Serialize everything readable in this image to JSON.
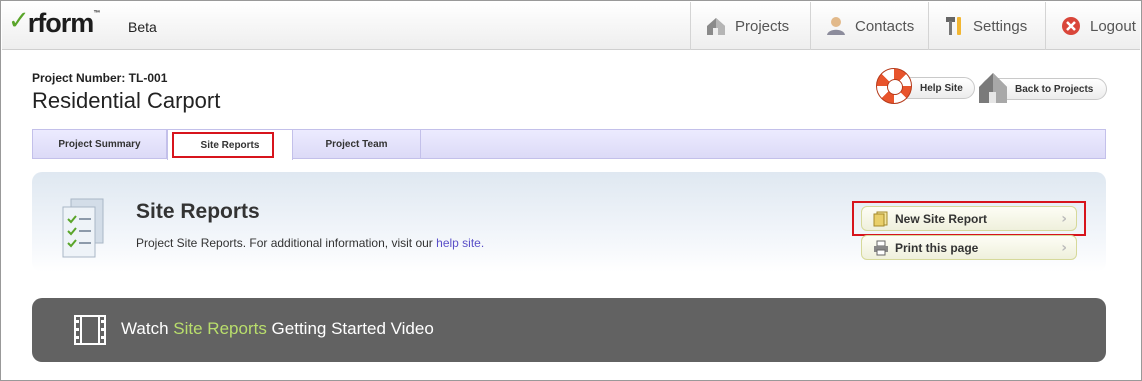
{
  "app": {
    "logo_text": "rform",
    "logo_tm": "™",
    "badge": "Beta"
  },
  "nav": {
    "projects": "Projects",
    "contacts": "Contacts",
    "settings": "Settings",
    "logout": "Logout"
  },
  "project": {
    "number_label": "Project Number: TL-001",
    "title": "Residential Carport"
  },
  "header_buttons": {
    "help": "Help Site",
    "back": "Back to Projects"
  },
  "tabs": [
    {
      "label": "Project Summary"
    },
    {
      "label": "Site Reports"
    },
    {
      "label": "Project Team"
    }
  ],
  "section": {
    "title": "Site Reports",
    "description": "Project Site Reports. For additional information, visit our ",
    "help_link": "help site."
  },
  "actions": {
    "new_report": "New Site Report",
    "print": "Print this page"
  },
  "video": {
    "prefix": "Watch ",
    "highlight": "Site Reports",
    "suffix": " Getting Started Video"
  },
  "colors": {
    "accent_green": "#5aa52a",
    "highlight": "#d7141c",
    "link": "#5a4fc8",
    "video_highlight": "#b9de6c"
  }
}
